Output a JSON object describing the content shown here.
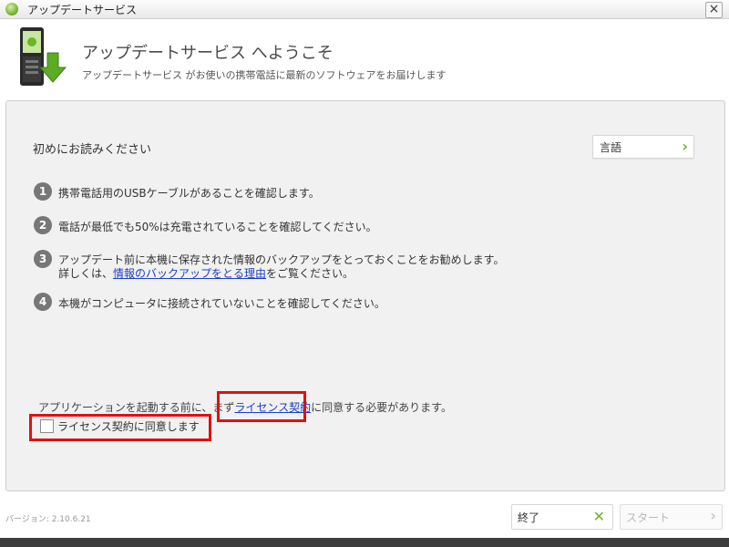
{
  "window": {
    "title": "アップデートサービス",
    "close_label": "×"
  },
  "header": {
    "title": "アップデートサービス へようこそ",
    "subtitle": "アップデートサービス がお使いの携帯電話に最新のソフトウェアをお届けします"
  },
  "main": {
    "section_title": "初めにお読みください",
    "language_button": "言語",
    "steps": [
      {
        "num": "1",
        "text": "携帯電話用のUSBケーブルがあることを確認します。"
      },
      {
        "num": "2",
        "text": "電話が最低でも50%は充電されていることを確認してください。"
      },
      {
        "num": "3",
        "line1": "アップデート前に本機に保存された情報のバックアップをとっておくことをお勧めします。",
        "line2_prefix": "詳しくは、",
        "link": "情報のバックアップをとる理由",
        "line2_suffix": "をご覧ください。"
      },
      {
        "num": "4",
        "text": "本機がコンピュータに接続されていないことを確認してください。"
      }
    ],
    "license_prefix": "アプリケーションを起動する前に、まず",
    "license_link": "ライセンス契約",
    "license_suffix": "に同意する必要があります。",
    "agree_label": "ライセンス契約に同意します"
  },
  "footer": {
    "version": "バージョン: 2.10.6.21",
    "exit_label": "終了",
    "start_label": "スタート"
  },
  "colors": {
    "accent_green": "#6ab62b",
    "highlight_red": "#e01010",
    "link_blue": "#1d3fc7"
  }
}
